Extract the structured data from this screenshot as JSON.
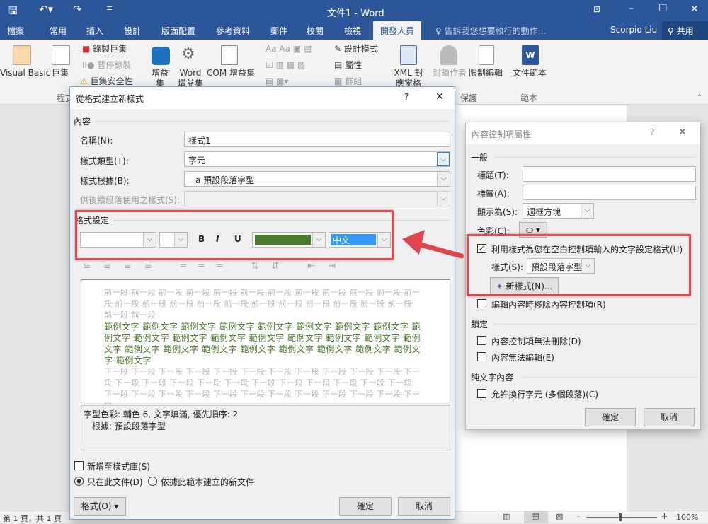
{
  "window": {
    "title": "文件1 - Word",
    "user": "Scorpio Liu",
    "share": "共用"
  },
  "tabs": [
    "檔案",
    "常用",
    "插入",
    "設計",
    "版面配置",
    "參考資料",
    "郵件",
    "校閱",
    "檢視",
    "開發人員"
  ],
  "tell_me": "告訴我您想要執行的動作...",
  "ribbon": {
    "visual_basic": "Visual Basic",
    "macros": "巨集",
    "record_macro": "錄製巨集",
    "pause_recording": "暫停錄製",
    "macro_security": "巨集安全性",
    "group_code": "程式",
    "addins": "增益集",
    "word_addins": "Word 增益集",
    "com_addins": "COM 增益集",
    "design_mode": "設計模式",
    "properties": "屬性",
    "group": "群組",
    "xml_pane": "XML 對應窗格",
    "block_authors": "封鎖作者",
    "restrict_editing": "限制編輯",
    "group_protect": "保護",
    "doc_template": "文件範本",
    "group_templates": "範本"
  },
  "new_style_dialog": {
    "title": "從格式建立新樣式",
    "help": "?",
    "section_properties": "內容",
    "name_label": "名稱(N):",
    "name_value": "樣式1",
    "type_label": "樣式類型(T):",
    "type_value": "字元",
    "based_label": "樣式根據(B):",
    "based_value": "a 預設段落字型",
    "next_label": "供後續段落使用之樣式(S):",
    "section_formatting": "格式設定",
    "bold": "B",
    "italic": "I",
    "underline": "U",
    "font_color": "#4a7b2e",
    "script_value": "中文",
    "preview_prev": "前一段 前一段 前一段 前一段 前一段 前一段 前一段 前一段 前一段 前一段 前一段 前一段 前一段 前一段 前一段 前一段 前一段 前一段 前一段 前一段 前一段 前一段 前一段 前一段 前一段",
    "preview_sample": "範例文字 範例文字 範例文字 範例文字 範例文字 範例文字 範例文字 範例文字 範例文字 範例文字 範例文字 範例文字 範例文字 範例文字 範例文字 範例文字 範例文字 範例文字 範例文字 範例文字 範例文字 範例文字 範例文字 範例文字 範例文字 範例文字",
    "preview_next": "下一段 下一段 下一段 下一段 下一段 下一段 下一段 下一段 下一段 下一段 下一段 下一段 下一段 下一段 下一段 下一段 下一段 下一段 下一段 下一段 下一段 下一段 下一段 下一段 下一段 下一段 下一段 下一段 下一段 下一段 下一段 下一段 下一段 下一段 下一段",
    "description_line1": "字型色彩: 輔色 6, 文字填滿, 優先順序: 2",
    "description_line2": "根據: 預設段落字型",
    "add_to_gallery": "新增至樣式庫(S)",
    "only_this_doc": "只在此文件(D)",
    "new_docs_template": "依據此範本建立的新文件",
    "format_button": "格式(O) ▾",
    "ok": "確定",
    "cancel": "取消"
  },
  "content_control_dialog": {
    "title": "內容控制項屬性",
    "help": "?",
    "section_general": "一般",
    "title_label": "標題(T):",
    "tag_label": "標籤(A):",
    "show_as_label": "顯示為(S):",
    "show_as_value": "週框方塊",
    "color_label": "色彩(C):",
    "use_style": "利用樣式為您在空白控制項輸入的文字設定格式(U)",
    "style_label": "樣式(S):",
    "style_value": "預設段落字型",
    "new_style_button": "新樣式(N)...",
    "remove_when_edited": "編輯內容時移除內容控制項(R)",
    "section_locking": "鎖定",
    "cannot_delete": "內容控制項無法刪除(D)",
    "cannot_edit": "內容無法編輯(E)",
    "section_plain_text": "純文字內容",
    "allow_returns": "允許換行字元 (多個段落)(C)",
    "ok": "確定",
    "cancel": "取消"
  },
  "status": {
    "page": "第 1 頁，共 1 頁",
    "zoom": "100%"
  }
}
